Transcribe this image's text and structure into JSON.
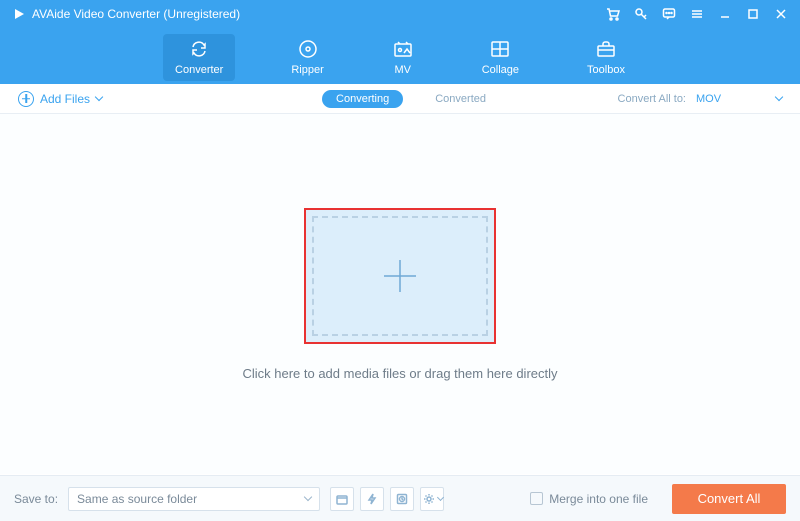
{
  "titlebar": {
    "app_name": "AVAide Video Converter (Unregistered)"
  },
  "tabs": {
    "converter": "Converter",
    "ripper": "Ripper",
    "mv": "MV",
    "collage": "Collage",
    "toolbox": "Toolbox"
  },
  "subbar": {
    "add_files": "Add Files",
    "converting": "Converting",
    "converted": "Converted",
    "convert_all_to": "Convert All to:",
    "format_selected": "MOV"
  },
  "drop": {
    "text": "Click here to add media files or drag them here directly"
  },
  "bottom": {
    "save_to_label": "Save to:",
    "save_to_value": "Same as source folder",
    "merge_label": "Merge into one file",
    "convert_all": "Convert All"
  }
}
